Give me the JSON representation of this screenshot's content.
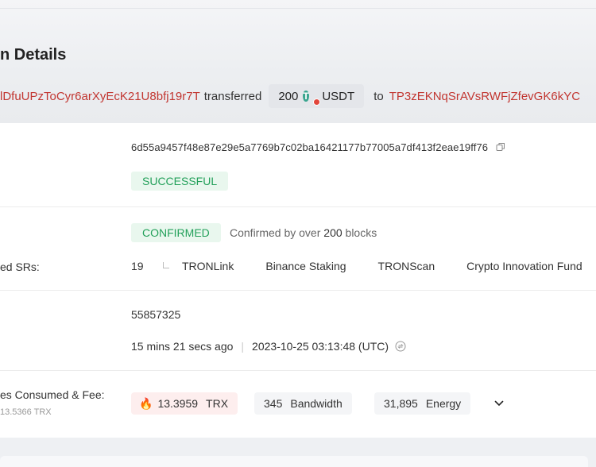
{
  "header": {
    "title": "n Details"
  },
  "summary": {
    "from_address": "lDfuUPzToCyr6arXyEcK21U8bfj19r7T",
    "transferred_text": "transferred",
    "amount": "200",
    "token_icon": "tether-icon",
    "token_symbol": "USDT",
    "to_text": "to",
    "to_address": "TP3zEKNqSrAVsRWFjZfevGK6kYC"
  },
  "details": {
    "hash": "6d55a9457f48e87e29e5a7769b7c02ba16421177b77005a7df413f2eae19ff76",
    "status": "SUCCESSFUL",
    "confirmation_status": "CONFIRMED",
    "confirmed_prefix": "Confirmed by over",
    "confirmed_blocks": "200",
    "confirmed_suffix": "blocks",
    "srs_label": "ed SRs:",
    "srs_count": "19",
    "srs": [
      "TRONLink",
      "Binance Staking",
      "TRONScan",
      "Crypto Innovation Fund"
    ],
    "block": "55857325",
    "age": "15 mins 21 secs ago",
    "timestamp": "2023-10-25 03:13:48 (UTC)",
    "resources_label": "es Consumed & Fee:",
    "resources_sub": "13.5366 TRX",
    "fee_trx_value": "13.3959",
    "fee_trx_unit": "TRX",
    "bandwidth_value": "345",
    "bandwidth_unit": "Bandwidth",
    "energy_value": "31,895",
    "energy_unit": "Energy"
  },
  "colors": {
    "address": "#c23631",
    "success_text": "#23a05a",
    "success_bg": "#e9f7ee",
    "fee_bg": "#fdeeee"
  }
}
